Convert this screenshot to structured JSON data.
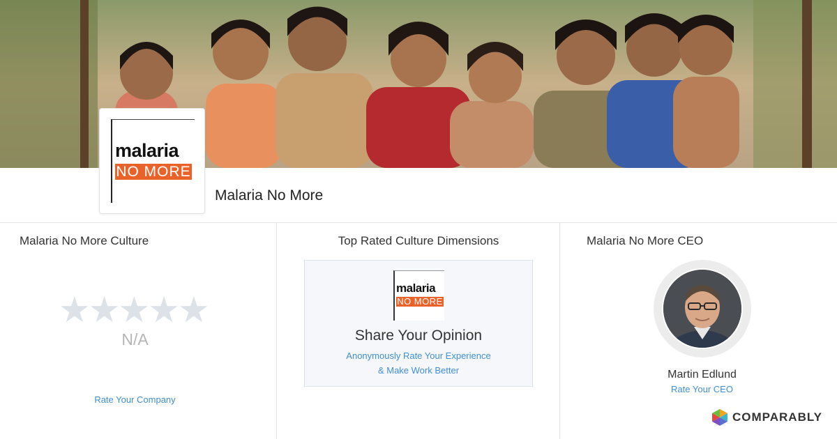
{
  "banner": {
    "image": "smiling-children-photo"
  },
  "company": {
    "name": "Malaria No More",
    "logo_word": "malaria",
    "logo_tag": "NO MORE",
    "brand_color": "#e8622a"
  },
  "culture": {
    "title": "Malaria No More Culture",
    "stars_total": 5,
    "stars_filled": 0,
    "score": "N/A",
    "rate_link": "Rate Your Company"
  },
  "dimensions": {
    "title": "Top Rated Culture Dimensions",
    "card_title": "Share Your Opinion",
    "card_line1": "Anonymously Rate Your Experience",
    "card_line2": "& Make Work Better"
  },
  "ceo": {
    "title": "Malaria No More CEO",
    "name": "Martin Edlund",
    "rate_link": "Rate Your CEO"
  },
  "footer": {
    "brand": "COMPARABLY"
  },
  "colors": {
    "link": "#3f8ed8",
    "star_empty": "#dde2e8",
    "accent": "#e8622a"
  }
}
